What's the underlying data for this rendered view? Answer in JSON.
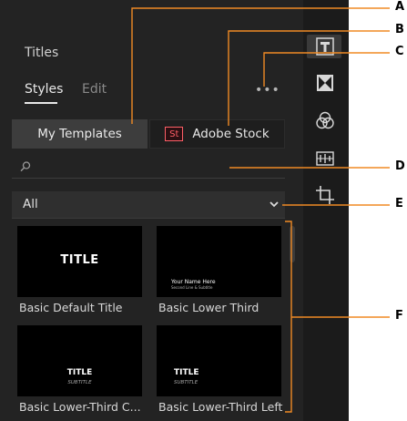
{
  "panel": {
    "title": "Titles",
    "tabs": [
      {
        "label": "Styles",
        "active": true
      },
      {
        "label": "Edit",
        "active": false
      }
    ],
    "more_label": "•••"
  },
  "template_source": {
    "my_templates": "My Templates",
    "adobe_stock": "Adobe Stock",
    "stock_badge": "St"
  },
  "search": {
    "placeholder": ""
  },
  "filter": {
    "selected": "All"
  },
  "templates": [
    {
      "label": "Basic Default Title",
      "thumb_title": "TITLE"
    },
    {
      "label": "Basic Lower Third",
      "thumb_name": "Your Name Here",
      "thumb_sub": "Second Line & Subtitle"
    },
    {
      "label": "Basic Lower-Third C...",
      "thumb_title": "TITLE",
      "thumb_sub": "SUBTITLE"
    },
    {
      "label": "Basic Lower-Third Left",
      "thumb_title": "TITLE",
      "thumb_sub": "SUBTITLE"
    }
  ],
  "rail_icons": [
    "titles-icon",
    "transitions-icon",
    "color-icon",
    "audio-icon",
    "crop-icon"
  ],
  "callouts": [
    "A",
    "B",
    "C",
    "D",
    "E",
    "F"
  ],
  "colors": {
    "callout_line": "#f08a24",
    "stock_badge": "#ff5f67",
    "panel_bg": "#232323"
  }
}
